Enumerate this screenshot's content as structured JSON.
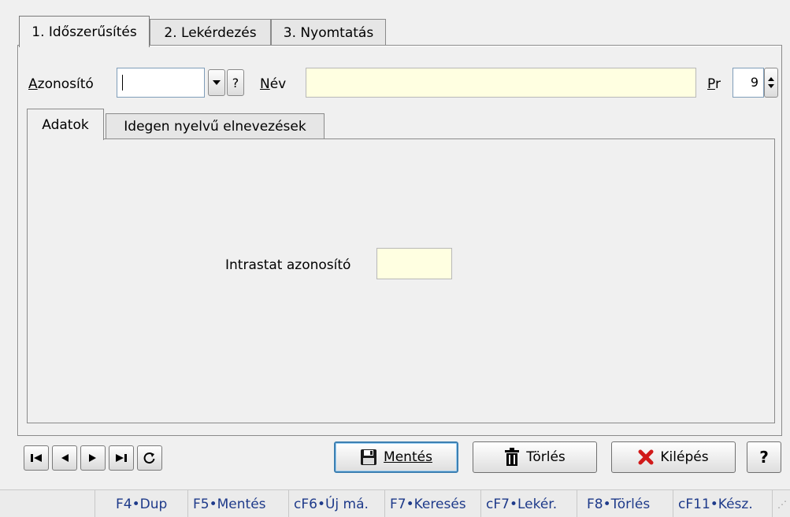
{
  "tabs": [
    {
      "label": "1. Időszerűsítés",
      "active": true
    },
    {
      "label": "2. Lekérdezés",
      "active": false
    },
    {
      "label": "3. Nyomtatás",
      "active": false
    }
  ],
  "form": {
    "azonosito_label": "Azonosító",
    "azonosito_value": "",
    "help_button": "?",
    "nev_label": "Név",
    "nev_value": "",
    "pr_label": "Pr",
    "pr_value": "9"
  },
  "inner_tabs": [
    {
      "label": "Adatok",
      "active": true
    },
    {
      "label": "Idegen nyelvű elnevezések",
      "active": false
    }
  ],
  "adatok": {
    "intrastat_label": "Intrastat azonosító",
    "intrastat_value": ""
  },
  "buttons": {
    "save": "Mentés",
    "delete": "Törlés",
    "exit": "Kilépés",
    "help": "?"
  },
  "statusbar": [
    "F4•Dup",
    "F5•Mentés",
    "cF6•Új má.",
    "F7•Keresés",
    "cF7•Lekér.",
    "F8•Törlés",
    "cF11•Kész."
  ],
  "colors": {
    "field_yellow": "#ffffe1",
    "status_text": "#1e3a8a",
    "exit_icon": "#d11a1a",
    "default_button_border": "#3c7fb1"
  }
}
